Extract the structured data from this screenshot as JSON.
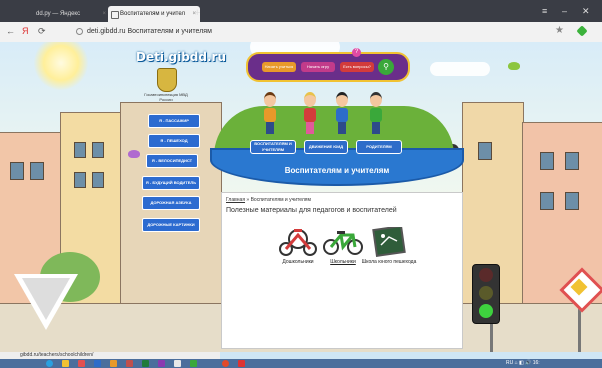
{
  "browser": {
    "tabs": [
      {
        "label": "dd.ру — Яндекс"
      },
      {
        "label": "Воспитателям и учител"
      }
    ],
    "address": "deti.gibdd.ru  Воспитателям и учителям",
    "nav": {
      "back": "←",
      "yandex": "Я",
      "reload": "⟳"
    }
  },
  "site": {
    "logo": "Deti.gibdd.ru",
    "emblem_caption": "Госавтоинспекция МВД России",
    "top_menu": [
      "Начать учиться",
      "Начать игру",
      "Есть вопросы?"
    ],
    "audience_buttons": [
      "ВОСПИТАТЕЛЯМ И УЧИТЕЛЯМ",
      "ДВИЖЕНИЕ ЮИД",
      "РОДИТЕЛЯМ"
    ],
    "banner": "Воспитателям и учителям",
    "side_menu": [
      "Я - ПАССАЖИР",
      "Я - ПЕШЕХОД",
      "Я - ВЕЛОСИПЕДИСТ",
      "Я - БУДУЩИЙ ВОДИТЕЛЬ",
      "ДОРОЖНАЯ АЗБУКА",
      "ДОРОЖНЫЕ КАРТИНКИ"
    ]
  },
  "content": {
    "breadcrumb_home": "Главная",
    "breadcrumb_sep": "»",
    "breadcrumb_current": "Воспитателям и учителям",
    "title": "Полезные материалы для педагогов и воспитателей",
    "items": [
      {
        "label": "Дошкольники"
      },
      {
        "label": "Школьники"
      },
      {
        "label": "Школа юного пешехода"
      }
    ]
  },
  "status_url": "gibdd.ru/teachers/schoolchildren/",
  "tray": "RU ⌂ ◧ 🔊 16:",
  "colors": {
    "accent": "#2a78d0",
    "menu_bg": "#6a2e8a",
    "grass": "#6bb13a"
  }
}
